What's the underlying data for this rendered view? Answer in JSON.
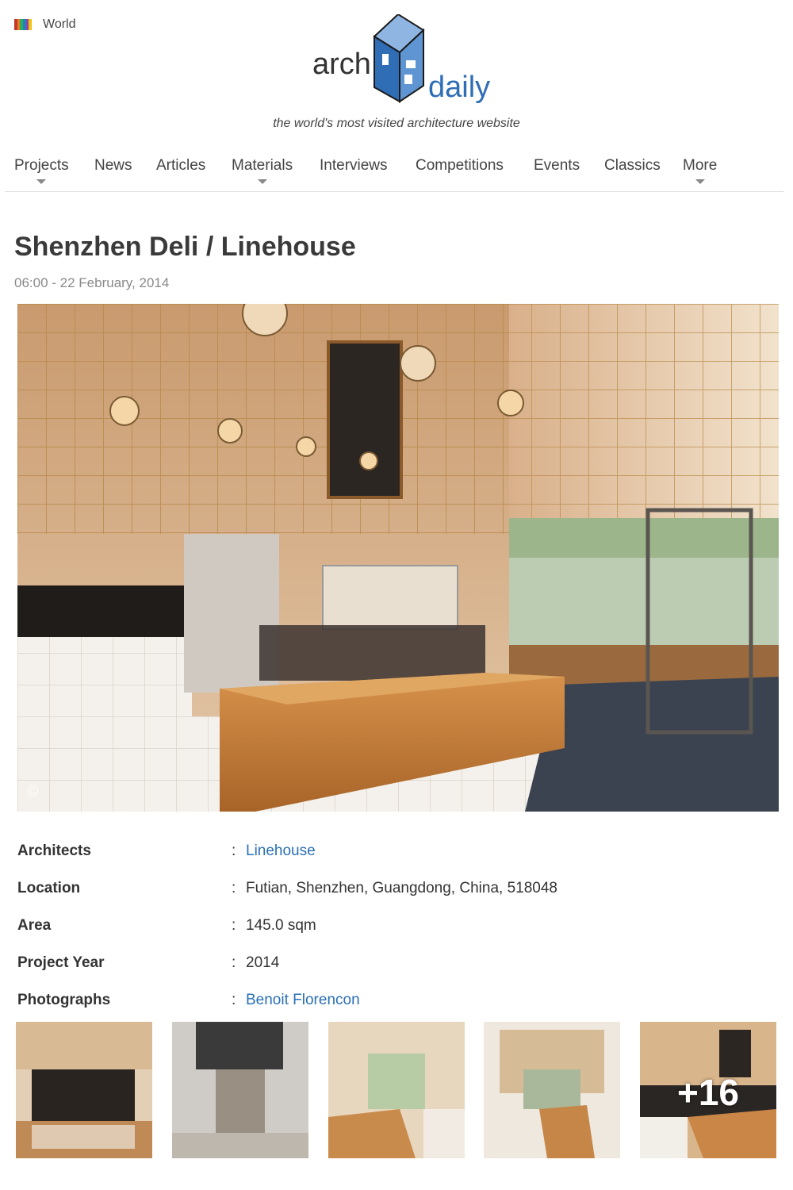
{
  "header": {
    "region_label": "World",
    "logo": {
      "word1": "arch",
      "word2": "daily",
      "icon": "archdaily-building-logo"
    },
    "tagline": "the world's most visited architecture website"
  },
  "nav": {
    "items": [
      {
        "label": "Projects",
        "dropdown": true
      },
      {
        "label": "News",
        "dropdown": false
      },
      {
        "label": "Articles",
        "dropdown": false
      },
      {
        "label": "Materials",
        "dropdown": true
      },
      {
        "label": "Interviews",
        "dropdown": false
      },
      {
        "label": "Competitions",
        "dropdown": false
      },
      {
        "label": "Events",
        "dropdown": false
      },
      {
        "label": "Classics",
        "dropdown": false
      },
      {
        "label": "More",
        "dropdown": true
      }
    ]
  },
  "article": {
    "title": "Shenzhen Deli / Linehouse",
    "date": "06:00 - 22 February, 2014",
    "hero_copyright": "©",
    "specs": [
      {
        "label": "Architects",
        "value": "Linehouse",
        "link": true
      },
      {
        "label": "Location",
        "value": "Futian, Shenzhen, Guangdong, China, 518048",
        "link": false
      },
      {
        "label": "Area",
        "value": "145.0 sqm",
        "link": false
      },
      {
        "label": "Project Year",
        "value": "2014",
        "link": false
      },
      {
        "label": "Photographs",
        "value": "Benoit Florencon",
        "link": true
      }
    ],
    "spec_separator": ":",
    "gallery_more_label": "+16"
  },
  "colors": {
    "link": "#2a6fb5",
    "logo_blue": "#2f6db5",
    "text": "#333333",
    "muted": "#8a8a8a"
  }
}
